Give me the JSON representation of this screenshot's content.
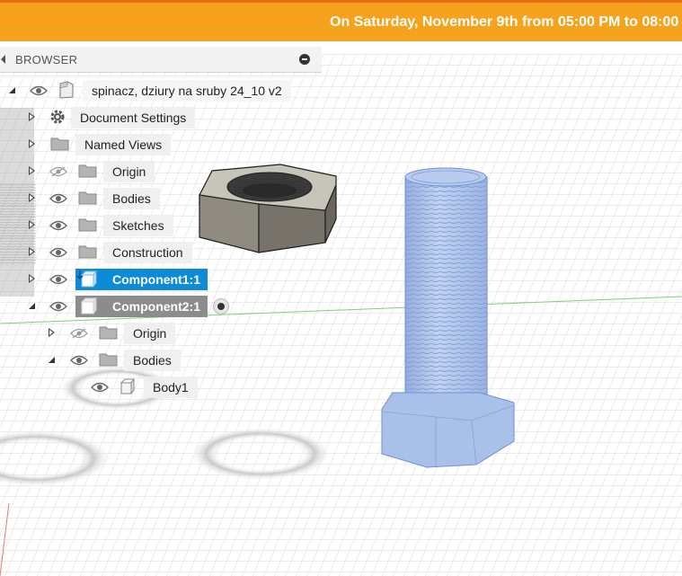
{
  "banner": {
    "text": "On Saturday, November 9th from 05:00 PM to 08:00",
    "color": "#f7a21c"
  },
  "browser": {
    "title": "BROWSER",
    "document_name": "spinacz, dziury na sruby 24_10 v2",
    "items": [
      {
        "label": "Document Settings",
        "icon": "gear-icon"
      },
      {
        "label": "Named Views",
        "icon": "folder-icon"
      },
      {
        "label": "Origin",
        "icon": "folder-icon",
        "visibility": "hidden"
      },
      {
        "label": "Bodies",
        "icon": "folder-icon"
      },
      {
        "label": "Sketches",
        "icon": "folder-icon"
      },
      {
        "label": "Construction",
        "icon": "folder-icon"
      },
      {
        "label": "Component1:1",
        "icon": "component-icon",
        "state": "selected"
      },
      {
        "label": "Component2:1",
        "icon": "component-icon",
        "state": "active"
      },
      {
        "label": "Origin",
        "icon": "folder-icon",
        "visibility": "hidden"
      },
      {
        "label": "Bodies",
        "icon": "folder-icon"
      },
      {
        "label": "Body1",
        "icon": "body-icon"
      }
    ]
  },
  "colors": {
    "selection": "#0d8bd9",
    "active_component": "#8c8c8c",
    "bolt_highlight": "#a9c0e8",
    "nut": "#8e8a80"
  }
}
